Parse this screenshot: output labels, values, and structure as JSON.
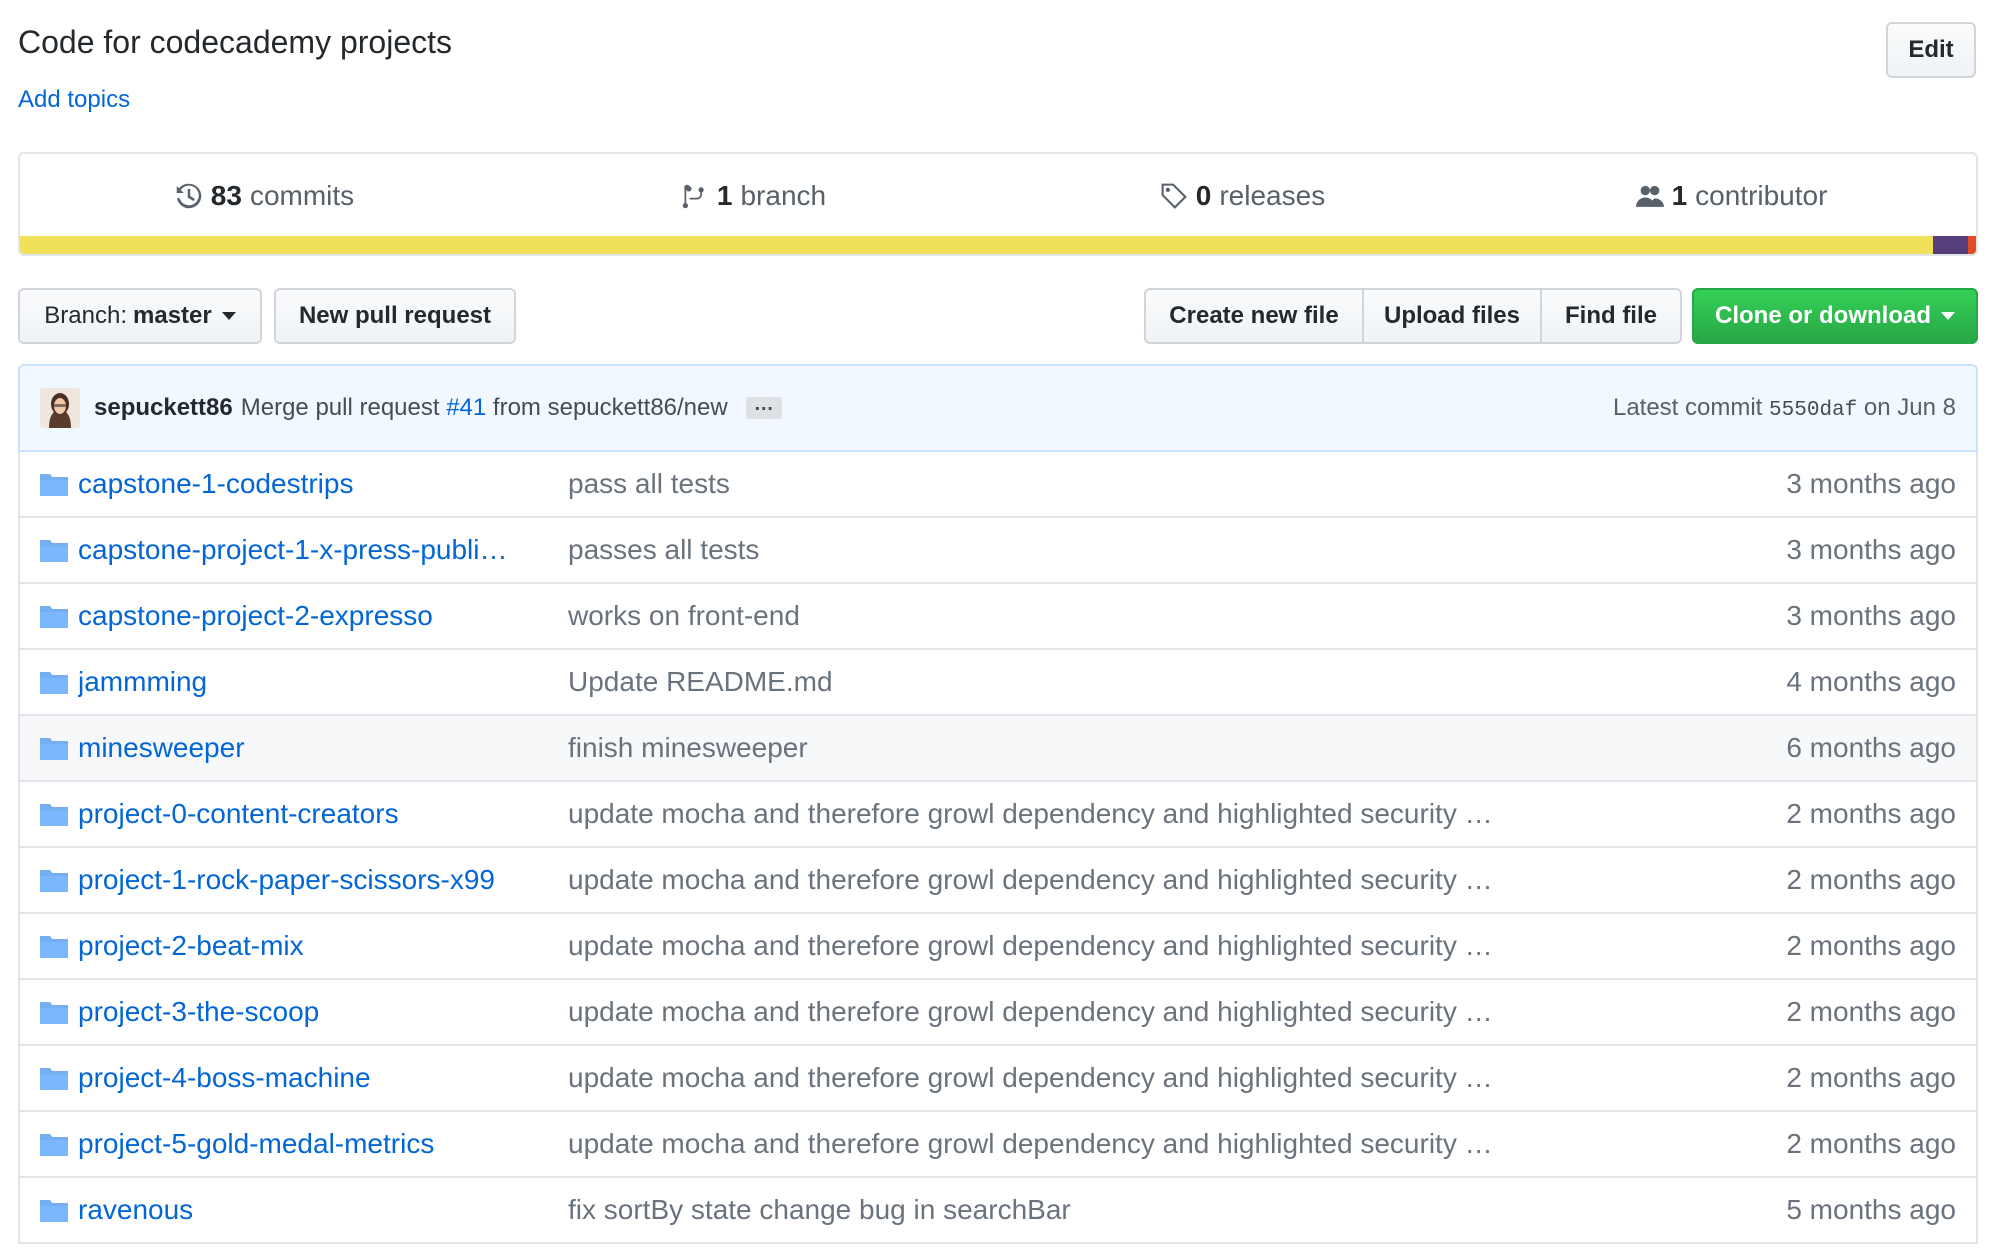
{
  "repo": {
    "description": "Code for codecademy projects",
    "add_topics": "Add topics",
    "edit_label": "Edit"
  },
  "summary": {
    "commits_count": "83",
    "commits_label": "commits",
    "branch_count": "1",
    "branch_label": "branch",
    "releases_count": "0",
    "releases_label": "releases",
    "contributor_count": "1",
    "contributor_label": "contributor"
  },
  "language_bar": [
    {
      "color": "#f1e05a",
      "fraction": 0.978
    },
    {
      "color": "#563d7c",
      "fraction": 0.018
    },
    {
      "color": "#e34c26",
      "fraction": 0.004
    }
  ],
  "toolbar": {
    "branch_prefix": "Branch:",
    "branch_name": "master",
    "new_pr": "New pull request",
    "create_file": "Create new file",
    "upload_files": "Upload files",
    "find_file": "Find file",
    "clone": "Clone or download"
  },
  "commit": {
    "author": "sepuckett86",
    "message_pre": "Merge pull request",
    "pr_link": "#41",
    "message_post": "from sepuckett86/new",
    "ellipsis": "…",
    "latest_prefix": "Latest commit",
    "sha": "5550daf",
    "date": "on Jun 8"
  },
  "files": [
    {
      "name": "capstone-1-codestrips",
      "message": "pass all tests",
      "age": "3 months ago"
    },
    {
      "name": "capstone-project-1-x-press-publi…",
      "message": "passes all tests",
      "age": "3 months ago"
    },
    {
      "name": "capstone-project-2-expresso",
      "message": "works on front-end",
      "age": "3 months ago"
    },
    {
      "name": "jammming",
      "message": "Update README.md",
      "age": "4 months ago"
    },
    {
      "name": "minesweeper",
      "message": "finish minesweeper",
      "age": "6 months ago"
    },
    {
      "name": "project-0-content-creators",
      "message": "update mocha and therefore growl dependency and highlighted security …",
      "age": "2 months ago"
    },
    {
      "name": "project-1-rock-paper-scissors-x99",
      "message": "update mocha and therefore growl dependency and highlighted security …",
      "age": "2 months ago"
    },
    {
      "name": "project-2-beat-mix",
      "message": "update mocha and therefore growl dependency and highlighted security …",
      "age": "2 months ago"
    },
    {
      "name": "project-3-the-scoop",
      "message": "update mocha and therefore growl dependency and highlighted security …",
      "age": "2 months ago"
    },
    {
      "name": "project-4-boss-machine",
      "message": "update mocha and therefore growl dependency and highlighted security …",
      "age": "2 months ago"
    },
    {
      "name": "project-5-gold-medal-metrics",
      "message": "update mocha and therefore growl dependency and highlighted security …",
      "age": "2 months ago"
    },
    {
      "name": "ravenous",
      "message": "fix sortBy state change bug in searchBar",
      "age": "5 months ago"
    }
  ]
}
